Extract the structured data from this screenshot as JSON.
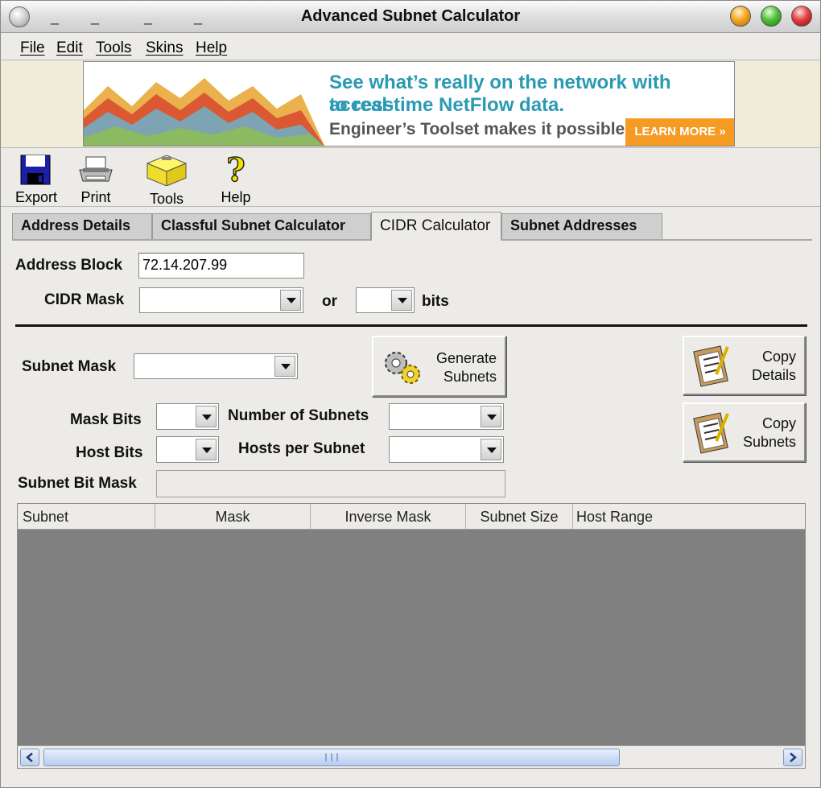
{
  "window": {
    "title": "Advanced Subnet Calculator"
  },
  "menu": [
    "File",
    "Edit",
    "Tools",
    "Skins",
    "Help"
  ],
  "ad": {
    "line1": "See what’s really on the network with access",
    "line2": "to real-time NetFlow data.",
    "line3": "Engineer’s Toolset makes it possible.",
    "cta": "LEARN MORE »"
  },
  "toolbar": [
    {
      "label": "Export",
      "icon": "floppy-disk-icon"
    },
    {
      "label": "Print",
      "icon": "printer-icon"
    },
    {
      "label": "Tools",
      "icon": "toolbox-icon"
    },
    {
      "label": "Help",
      "icon": "question-mark-icon"
    }
  ],
  "tabs": [
    {
      "label": "Address Details",
      "active": false
    },
    {
      "label": "Classful Subnet Calculator",
      "active": false
    },
    {
      "label": "CIDR Calculator",
      "active": true
    },
    {
      "label": "Subnet Addresses",
      "active": false
    }
  ],
  "form": {
    "address_block_label": "Address Block",
    "address_block_value": "72.14.207.99",
    "cidr_mask_label": "CIDR Mask",
    "cidr_mask_value": "",
    "or_label": "or",
    "bits_value": "",
    "bits_label": "bits",
    "subnet_mask_label": "Subnet Mask",
    "subnet_mask_value": "",
    "mask_bits_label": "Mask Bits",
    "host_bits_label": "Host Bits",
    "num_subnets_label": "Number of Subnets",
    "hosts_per_subnet_label": "Hosts per Subnet",
    "subnet_bit_mask_label": "Subnet Bit Mask"
  },
  "buttons": {
    "generate_line1": "Generate",
    "generate_line2": "Subnets",
    "copy_details_line1": "Copy",
    "copy_details_line2": "Details",
    "copy_subnets_line1": "Copy",
    "copy_subnets_line2": "Subnets"
  },
  "table": {
    "columns": [
      "Subnet",
      "Mask",
      "Inverse Mask",
      "Subnet Size",
      "Host Range"
    ],
    "rows": []
  }
}
